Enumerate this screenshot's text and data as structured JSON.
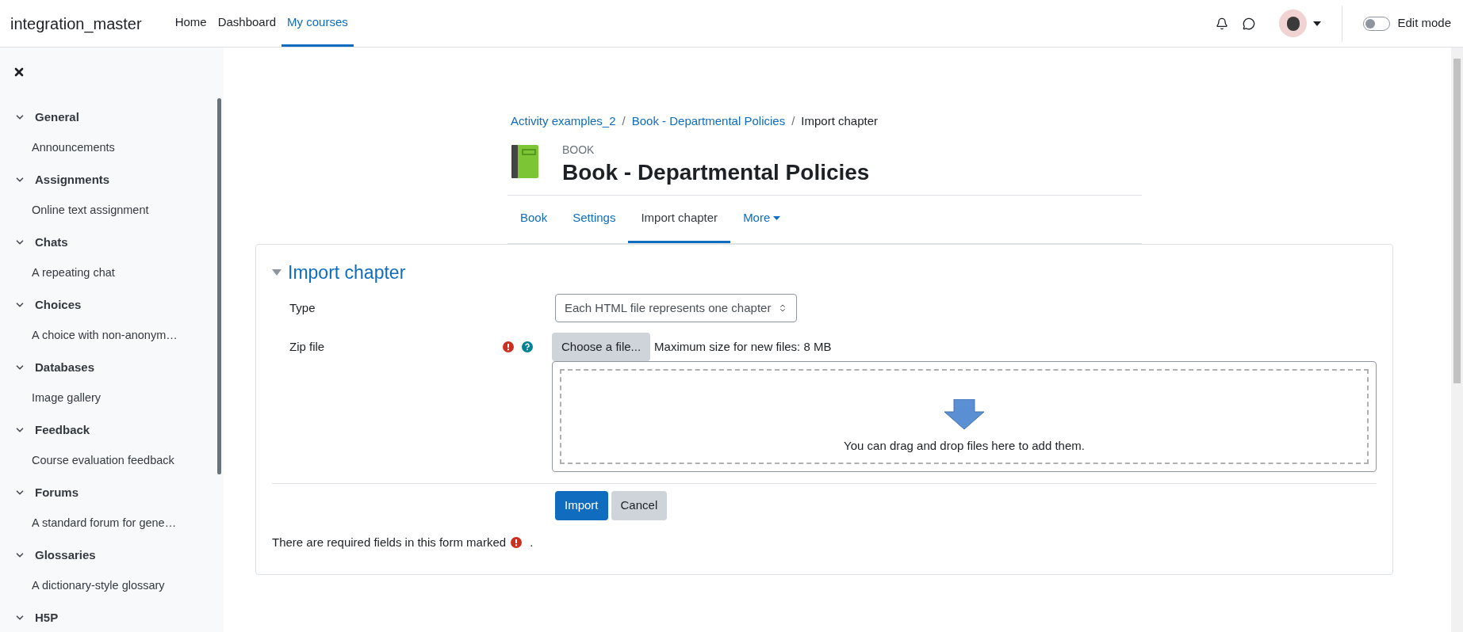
{
  "navbar": {
    "brand": "integration_master",
    "links": [
      {
        "label": "Home",
        "selected": false
      },
      {
        "label": "Dashboard",
        "selected": false
      },
      {
        "label": "My courses",
        "selected": true
      }
    ],
    "edit_mode": {
      "label": "Edit mode",
      "on": false
    }
  },
  "sidebar": {
    "sections": [
      {
        "title": "General",
        "expanded": true,
        "children": [
          {
            "label": "Announcements"
          }
        ]
      },
      {
        "title": "Assignments",
        "expanded": true,
        "children": [
          {
            "label": "Online text assignment"
          }
        ]
      },
      {
        "title": "Chats",
        "expanded": true,
        "children": [
          {
            "label": "A repeating chat"
          }
        ]
      },
      {
        "title": "Choices",
        "expanded": true,
        "children": [
          {
            "label": "A choice with non-anonym…"
          }
        ]
      },
      {
        "title": "Databases",
        "expanded": true,
        "children": [
          {
            "label": "Image gallery"
          }
        ]
      },
      {
        "title": "Feedback",
        "expanded": true,
        "children": [
          {
            "label": "Course evaluation feedback"
          }
        ]
      },
      {
        "title": "Forums",
        "expanded": true,
        "children": [
          {
            "label": "A standard forum for gene…"
          }
        ]
      },
      {
        "title": "Glossaries",
        "expanded": true,
        "children": [
          {
            "label": "A dictionary-style glossary"
          }
        ]
      },
      {
        "title": "H5P",
        "expanded": true
      }
    ]
  },
  "breadcrumb": [
    {
      "label": "Activity examples_2",
      "kind": "link"
    },
    {
      "label": "/",
      "kind": "separator"
    },
    {
      "label": "Book - Departmental Policies",
      "kind": "link"
    },
    {
      "label": "/",
      "kind": "separator"
    },
    {
      "label": "Import chapter",
      "kind": "current"
    }
  ],
  "header": {
    "kicker": "BOOK",
    "title": "Book - Departmental Policies"
  },
  "tabs": [
    {
      "label": "Book",
      "selected": false,
      "kind": "link"
    },
    {
      "label": "Settings",
      "selected": false,
      "kind": "link"
    },
    {
      "label": "Import chapter",
      "selected": true,
      "kind": "link"
    },
    {
      "label": "More",
      "selected": false,
      "kind": "dropdown"
    }
  ],
  "form": {
    "legend": "Import chapter",
    "expanded": true,
    "fields": [
      {
        "kind": "select",
        "label": "Type",
        "value": "Each HTML file represents one chapter"
      },
      {
        "kind": "filepicker",
        "label": "Zip file",
        "required": true,
        "help": true,
        "button": "Choose a file...",
        "note": "Maximum size for new files: 8 MB",
        "dropzone_text": "You can drag and drop files here to add them."
      }
    ],
    "buttons": [
      {
        "label": "Import",
        "kind": "primary"
      },
      {
        "label": "Cancel",
        "kind": "secondary"
      }
    ],
    "required_note": {
      "before": "There are required fields in this form marked",
      "after": "."
    }
  }
}
